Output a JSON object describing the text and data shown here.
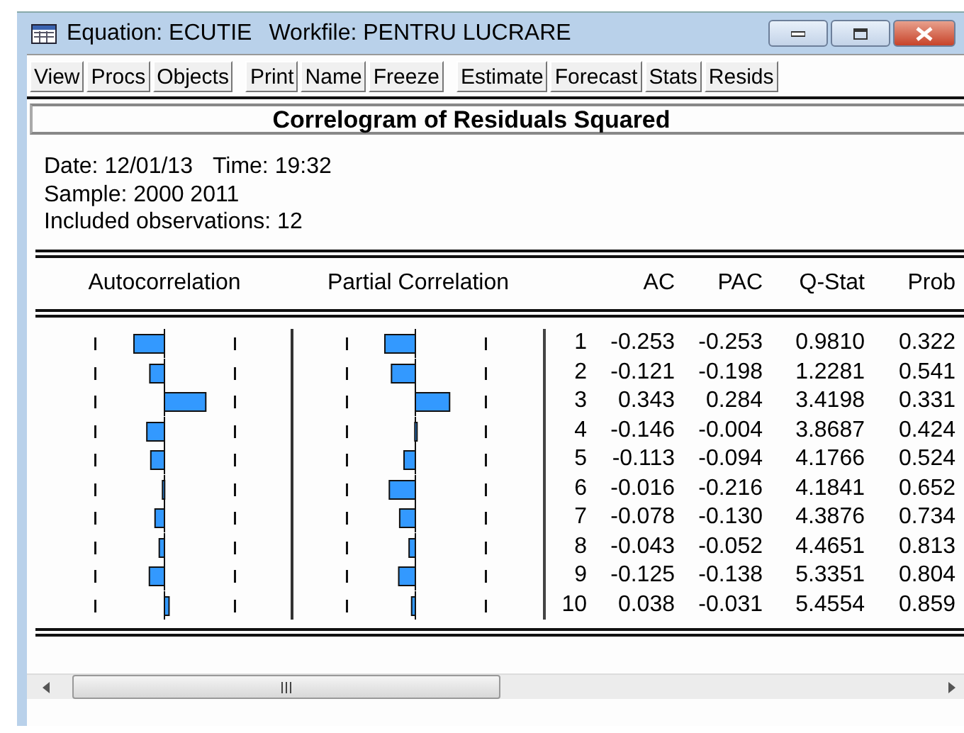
{
  "window": {
    "title": "Equation: ECUTIE",
    "workfile": "Workfile: PENTRU LUCRARE"
  },
  "toolbar": [
    {
      "buttons": [
        "View",
        "Procs",
        "Objects"
      ]
    },
    {
      "buttons": [
        "Print",
        "Name",
        "Freeze"
      ]
    },
    {
      "buttons": [
        "Estimate",
        "Forecast",
        "Stats",
        "Resids"
      ]
    }
  ],
  "header": "Correlogram of Residuals Squared",
  "info": {
    "date": "Date: 12/01/13",
    "time": "Time: 19:32",
    "sample": "Sample: 2000 2011",
    "observations": "Included observations: 12"
  },
  "columns": {
    "autocorrelation": "Autocorrelation",
    "partial": "Partial Correlation",
    "ac": "AC",
    "pac": "PAC",
    "q_stat": "Q-Stat",
    "prob": "Prob"
  },
  "rows": [
    {
      "lag": "1",
      "ac": "-0.253",
      "pac": "-0.253",
      "q_stat": "0.9810",
      "prob": "0.322"
    },
    {
      "lag": "2",
      "ac": "-0.121",
      "pac": "-0.198",
      "q_stat": "1.2281",
      "prob": "0.541"
    },
    {
      "lag": "3",
      "ac": "0.343",
      "pac": "0.284",
      "q_stat": "3.4198",
      "prob": "0.331"
    },
    {
      "lag": "4",
      "ac": "-0.146",
      "pac": "-0.004",
      "q_stat": "3.8687",
      "prob": "0.424"
    },
    {
      "lag": "5",
      "ac": "-0.113",
      "pac": "-0.094",
      "q_stat": "4.1766",
      "prob": "0.524"
    },
    {
      "lag": "6",
      "ac": "-0.016",
      "pac": "-0.216",
      "q_stat": "4.1841",
      "prob": "0.652"
    },
    {
      "lag": "7",
      "ac": "-0.078",
      "pac": "-0.130",
      "q_stat": "4.3876",
      "prob": "0.734"
    },
    {
      "lag": "8",
      "ac": "-0.043",
      "pac": "-0.052",
      "q_stat": "4.4651",
      "prob": "0.813"
    },
    {
      "lag": "9",
      "ac": "-0.125",
      "pac": "-0.138",
      "q_stat": "5.3351",
      "prob": "0.804"
    },
    {
      "lag": "10",
      "ac": "0.038",
      "pac": "-0.031",
      "q_stat": "5.4554",
      "prob": "0.859"
    }
  ]
}
